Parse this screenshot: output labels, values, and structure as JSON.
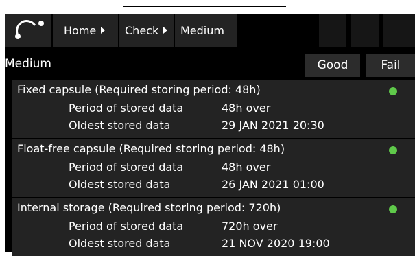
{
  "breadcrumb": {
    "home": "Home",
    "check": "Check",
    "medium": "Medium"
  },
  "page": {
    "title": "Medium",
    "good_label": "Good",
    "fail_label": "Fail"
  },
  "items": [
    {
      "title": "Fixed capsule (Required storing period: 48h)",
      "period_label": "Period of stored data",
      "period_value": "48h over",
      "oldest_label": "Oldest stored data",
      "oldest_value": "29 JAN 2021 20:30",
      "status": "good"
    },
    {
      "title": "Float-free capsule (Required storing period: 48h)",
      "period_label": "Period of stored data",
      "period_value": "48h over",
      "oldest_label": "Oldest stored data",
      "oldest_value": "26 JAN 2021 01:00",
      "status": "good"
    },
    {
      "title": "Internal storage (Required storing period: 720h)",
      "period_label": "Period of stored data",
      "period_value": "720h over",
      "oldest_label": "Oldest stored data",
      "oldest_value": "21 NOV 2020 19:00",
      "status": "good"
    }
  ],
  "colors": {
    "status_ok": "#5fc94a",
    "bar": "#232323",
    "button": "#2c2c2c"
  }
}
